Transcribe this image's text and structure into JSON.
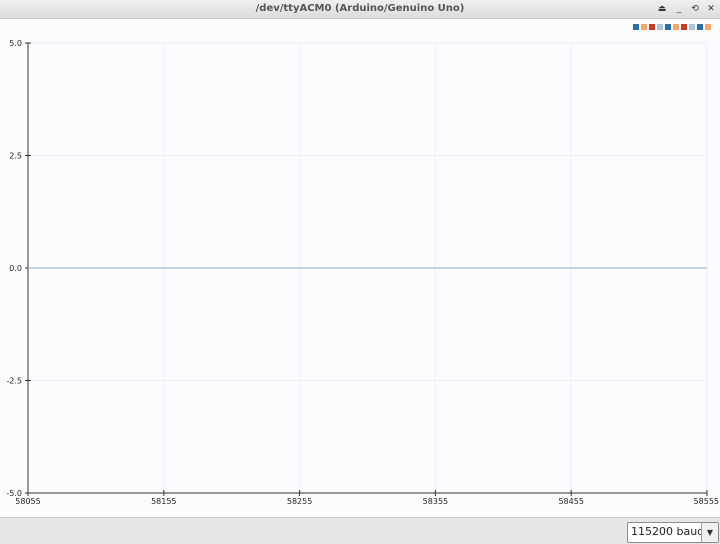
{
  "window": {
    "title": "/dev/ttyACM0 (Arduino/Genuino Uno)",
    "buttons": [
      {
        "name": "eject-icon",
        "glyph": "⏏"
      },
      {
        "name": "minimize-icon",
        "glyph": "_"
      },
      {
        "name": "restore-icon",
        "glyph": "⟲"
      },
      {
        "name": "close-icon",
        "glyph": "✕"
      }
    ]
  },
  "chart_data": {
    "type": "line",
    "x_ticks": [
      "58055",
      "58155",
      "58255",
      "58355",
      "58455",
      "58555"
    ],
    "xlim": [
      58055,
      58555
    ],
    "y_ticks": [
      "5.0",
      "2.5",
      "0.0",
      "-2.5",
      "-5.0"
    ],
    "ylim": [
      -5.0,
      5.0
    ],
    "grid": true,
    "legend_position": "top-right",
    "legend_colors": [
      "#2e6ea6",
      "#f2a86a",
      "#c93a2e",
      "#a9c8e0",
      "#2e6ea6",
      "#f2a86a",
      "#c93a2e",
      "#a9c8e0",
      "#2e6ea6",
      "#f2a86a"
    ],
    "series": [
      {
        "color": "#8ab0cc",
        "x": [
          58055,
          58555
        ],
        "y": [
          0,
          0
        ]
      }
    ]
  },
  "status": {
    "baud_label": "115200 baud",
    "dropdown_icon": "▼"
  }
}
